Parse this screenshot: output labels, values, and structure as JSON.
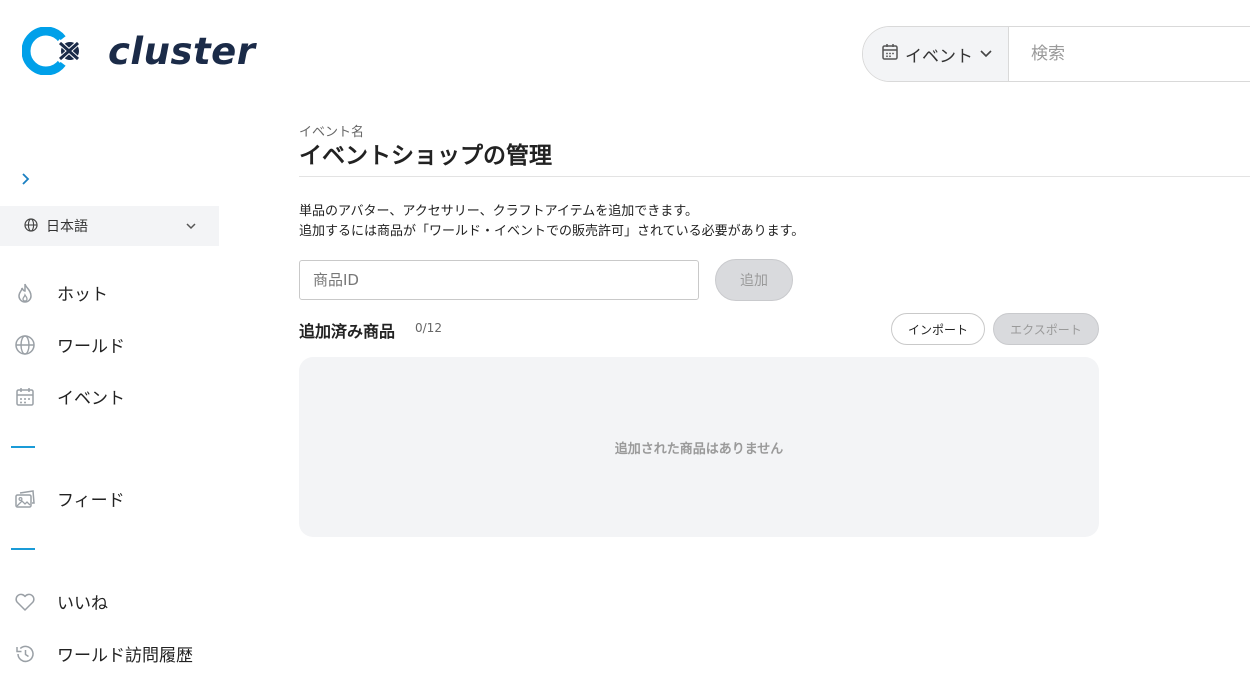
{
  "header": {
    "logo_text": "cluster",
    "brand_color": "#00a0e9",
    "search": {
      "type_label": "イベント",
      "placeholder": "検索"
    }
  },
  "sidebar": {
    "language": "日本語",
    "items": [
      {
        "label": "ホット",
        "icon": "fire-icon"
      },
      {
        "label": "ワールド",
        "icon": "globe-icon"
      },
      {
        "label": "イベント",
        "icon": "calendar-icon"
      },
      {
        "label": "フィード",
        "icon": "feed-icon"
      },
      {
        "label": "いいね",
        "icon": "heart-icon"
      },
      {
        "label": "ワールド訪問履歴",
        "icon": "history-icon"
      }
    ]
  },
  "main": {
    "eyebrow": "イベント名",
    "title": "イベントショップの管理",
    "description_line1": "単品のアバター、アクセサリー、クラフトアイテムを追加できます。",
    "description_line2": "追加するには商品が「ワールド・イベントでの販売許可」されている必要があります。",
    "product_input_placeholder": "商品ID",
    "add_label": "追加",
    "section_title": "追加済み商品",
    "count": "0/12",
    "import_label": "インポート",
    "export_label": "エクスポート",
    "empty_text": "追加された商品はありません"
  }
}
